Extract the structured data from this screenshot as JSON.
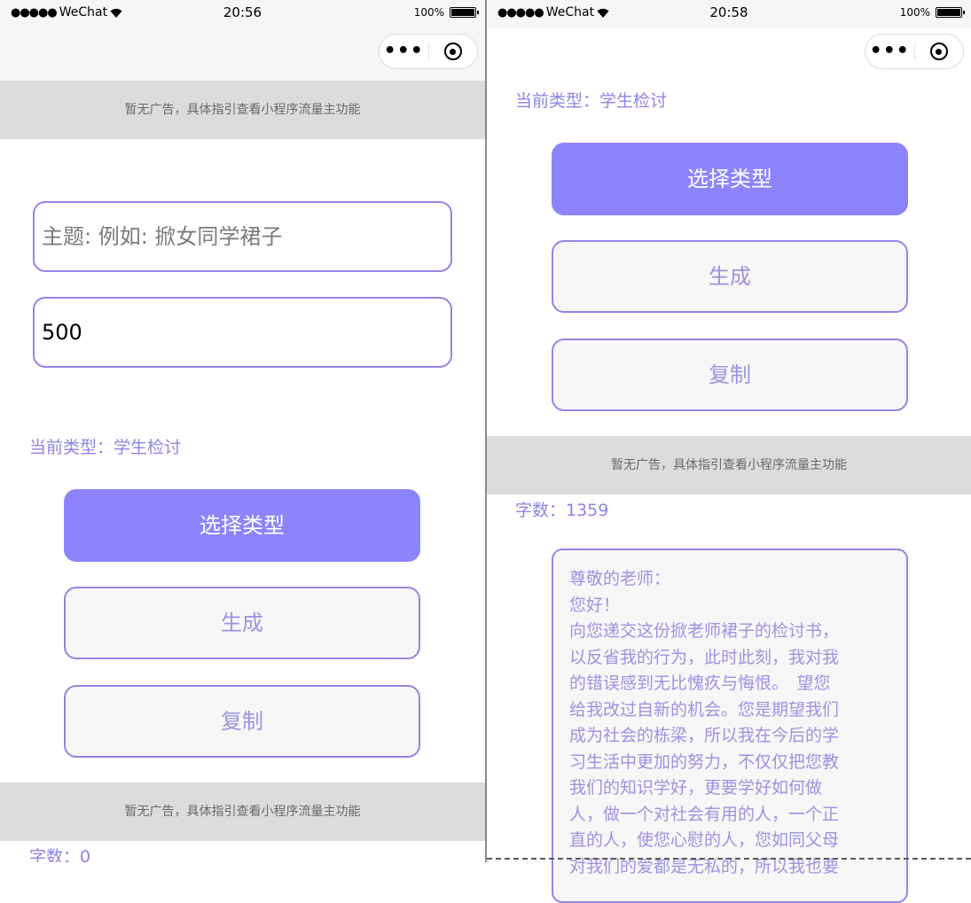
{
  "left_screen": {
    "status": {
      "signal": "●●●●●",
      "carrier": "WeChat",
      "time": "20:56",
      "battery": "100%"
    },
    "capsule": {
      "more": "•••"
    },
    "ad_top": "暂无广告，具体指引查看小程序流量主功能",
    "topic_input": {
      "placeholder": "主题: 例如: 掀女同学裙子"
    },
    "length_input": {
      "value": "500"
    },
    "current_type": "当前类型：学生检讨",
    "choose_type_button": "选择类型",
    "generate_button": "生成",
    "copy_button": "复制",
    "ad_bottom": "暂无广告，具体指引查看小程序流量主功能",
    "word_count": "字数：0"
  },
  "right_screen": {
    "status": {
      "signal": "●●●●●",
      "carrier": "WeChat",
      "time": "20:58",
      "battery": "100%"
    },
    "capsule": {
      "more": "•••"
    },
    "current_type": "当前类型：学生检讨",
    "choose_type_button": "选择类型",
    "generate_button": "生成",
    "copy_button": "复制",
    "ad": "暂无广告，具体指引查看小程序流量主功能",
    "word_count": "字数：1359",
    "result_lines": [
      "尊敬的老师：",
      "您好！",
      "向您递交这份掀老师裙子的检讨书，",
      "以反省我的行为，此时此刻，我对我",
      "的错误感到无比愧疚与悔恨。　望您",
      "给我改过自新的机会。您是期望我们",
      "成为社会的栋梁，所以我在今后的学",
      "习生活中更加的努力，不仅仅把您教",
      "我们的知识学好，更要学好如何做",
      "人，做一个对社会有用的人，一个正",
      "直的人，使您心慰的人，您如同父母",
      "对我们的爱都是无私的，所以我也要"
    ]
  }
}
